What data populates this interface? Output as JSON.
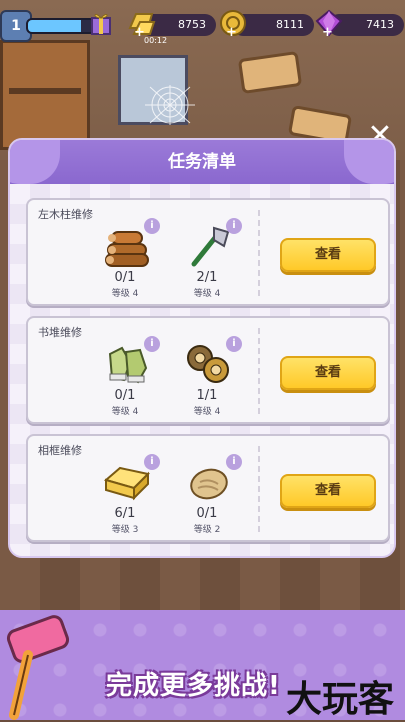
{
  "hud": {
    "level": "1",
    "xp_fraction": 0.8,
    "resources": [
      {
        "name": "gold-bar",
        "value": "8753",
        "sub": "00:12",
        "color": "#f2c94c"
      },
      {
        "name": "coin",
        "value": "8111",
        "color": "#e9b93a"
      },
      {
        "name": "gem",
        "value": "7413",
        "color": "#b24fd6"
      }
    ]
  },
  "panel": {
    "title": "任务清单",
    "tasks": [
      {
        "title": "左木柱维修",
        "items": [
          {
            "icon": "logs-icon",
            "count": "0/1",
            "level": "等级 4"
          },
          {
            "icon": "axe-icon",
            "count": "2/1",
            "level": "等级 4"
          }
        ],
        "button": "查看"
      },
      {
        "title": "书堆维修",
        "items": [
          {
            "icon": "gloves-icon",
            "count": "0/1",
            "level": "等级 4"
          },
          {
            "icon": "tape-icon",
            "count": "1/1",
            "level": "等级 4"
          }
        ],
        "button": "查看"
      },
      {
        "title": "相框维修",
        "items": [
          {
            "icon": "sponge-icon",
            "count": "6/1",
            "level": "等级 3"
          },
          {
            "icon": "bread-icon",
            "count": "0/1",
            "level": "等级 2"
          }
        ],
        "button": "查看"
      }
    ]
  },
  "banner": {
    "text": "完成更多挑战!"
  },
  "watermark": "大玩客",
  "icons": {
    "info": "i",
    "close": "✕",
    "plus": "+"
  }
}
